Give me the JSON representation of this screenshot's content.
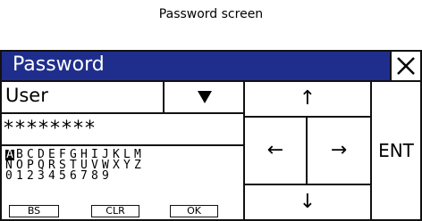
{
  "caption": "Password screen",
  "window": {
    "title": "Password",
    "close_icon": "close-x-icon"
  },
  "user_field": {
    "value": "User",
    "dropdown_icon": "triangle-down-icon"
  },
  "password_field": {
    "value": "********"
  },
  "keyboard": {
    "rows": [
      [
        "A",
        "B",
        "C",
        "D",
        "E",
        "F",
        "G",
        "H",
        "I",
        "J",
        "K",
        "L",
        "M"
      ],
      [
        "N",
        "O",
        "P",
        "Q",
        "R",
        "S",
        "T",
        "U",
        "V",
        "W",
        "X",
        "Y",
        "Z"
      ],
      [
        "0",
        "1",
        "2",
        "3",
        "4",
        "5",
        "6",
        "7",
        "8",
        "9"
      ]
    ],
    "selected": "A",
    "buttons": {
      "bs": "BS",
      "clr": "CLR",
      "ok": "OK"
    }
  },
  "navigation": {
    "up": "↑",
    "left": "←",
    "right": "→",
    "down": "↓",
    "enter": "ENT"
  }
}
